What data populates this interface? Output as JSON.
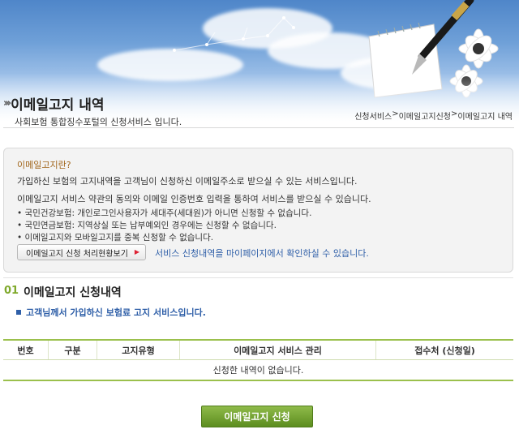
{
  "header": {
    "title": "이메일고지 내역",
    "subtitle": "사회보험 통합징수포털의 신청서비스 입니다.",
    "breadcrumb": [
      "신청서비스",
      ">",
      "이메일고지신청",
      ">",
      "이메일고지 내역"
    ]
  },
  "info_box": {
    "title": "이메일고지란?",
    "lines": [
      "가입하신 보험의 고지내역을 고객님이 신청하신 이메일주소로 받으실 수 있는 서비스입니다.",
      "이메일고지 서비스 약관의 동의와 이메일 인증번호 입력을 통하여 서비스를 받으실 수 있습니다."
    ],
    "bullets": [
      "• 국민건강보험: 개인로그인사용자가 세대주(세대원)가 아니면 신청할 수 없습니다.",
      "• 국민연금보험: 지역상실 또는 납부예외인 경우에는 신청할 수 없습니다.",
      "• 이메일고지와 모바일고지를 중복 신청할 수 없습니다."
    ],
    "status_button_label": "이메일고지 신청 처리현황보기",
    "mypage_note": "서비스 신청내역을 마이페이지에서 확인하실 수 있습니다."
  },
  "section": {
    "number": "01",
    "title": "이메일고지 신청내역",
    "description": "고객님께서 가입하신 보험료 고지 서비스입니다."
  },
  "table": {
    "columns": [
      "번호",
      "구분",
      "고지유형",
      "이메일고지 서비스 관리",
      "접수처 (신청일)"
    ],
    "empty_message": "신청한 내역이 없습니다."
  },
  "apply_button_label": "이메일고지 신청",
  "colors": {
    "accent_green": "#9bc04c",
    "link_blue": "#2f5fa8",
    "info_title_brown": "#a1651b"
  }
}
